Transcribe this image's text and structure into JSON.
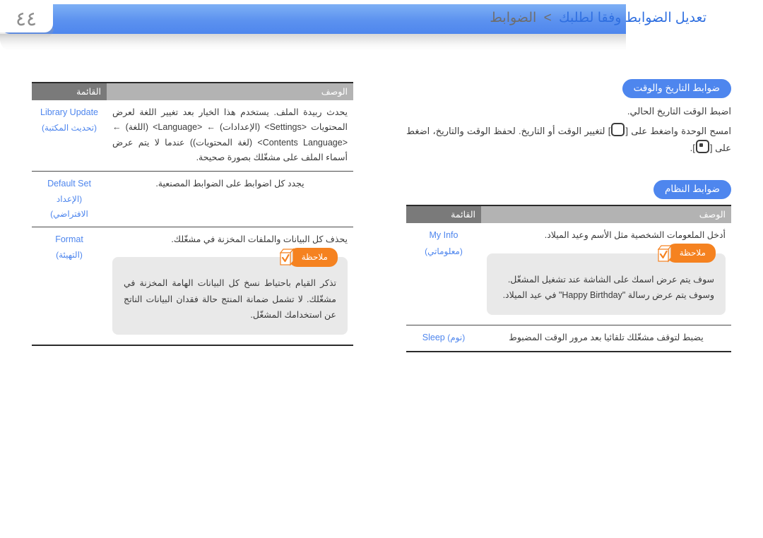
{
  "page": {
    "number": "٤٤"
  },
  "header": {
    "breadcrumb_current": "تعديل الضوابط وفقا لطلبك",
    "breadcrumb_separator": ">",
    "breadcrumb_parent": "الضوابط",
    "accent_color": "#4e86ee"
  },
  "table_headers": {
    "menu": "القائمة",
    "description": "الوصف"
  },
  "left_column": {
    "rows": [
      {
        "menu_en": "Library Update",
        "menu_ar": "(تحديث المكتبة)",
        "description": "يحدث ربيدة الملف. يستخدم هذا الخيار بعد تغيير اللغة لعرض المحتويات <Settings> (الإعدادات) ← <Language> (اللغة) ← <Contents Language> (لغة المحتويات)) عندما لا يتم عرض أسماء الملف على مشغّلك بصورة صحيحة."
      },
      {
        "menu_en": "Default Set",
        "menu_ar": "(الإعداد الافتراضي)",
        "description": "يجدد كل اضوابط على الضوابط المصنعية."
      },
      {
        "menu_en": "Format",
        "menu_ar": "(التهيئة)",
        "description": "يحذف كل البيانات والملفات المخزنة في مشغّلك.",
        "note": {
          "label": "ملاحظة",
          "text": "تذكر القيام باحتياط نسخ كل البيانات الهامة المخزنة في مشغّلك. لا تشمل ضمانة المنتج حالة فقدان البيانات الناتج عن استخدامك المشغّل."
        }
      }
    ]
  },
  "right_column": {
    "section_datetime": {
      "badge": "ضوابط التاريخ والوقت",
      "paragraph_1": "اضبط الوقت التاريخ الحالي.",
      "paragraph_2_before": "امسح الوحدة واضغط على [",
      "paragraph_2_mid": "] لتغيير الوقت أو التاريخ. لحفظ الوقت والتاريخ، اضغط على [",
      "paragraph_2_after": "]."
    },
    "section_system": {
      "badge": "ضوابط النظام",
      "rows": [
        {
          "menu_en": "My Info",
          "menu_ar": "(معلوماتي)",
          "description": "أدخل الملعومات الشخصية مثل الأسم وعيد الميلاد.",
          "note": {
            "label": "ملاحظة",
            "text_1": "سوف يتم عرض اسمك على الشاشة عند تشغيل المشغّل.",
            "text_2_before": "وسوف يتم عرض رسالة \"",
            "text_2_ltr": "Happy Birthday",
            "text_2_after": "\" في عيد الميلاد."
          }
        },
        {
          "menu_en": "Sleep",
          "menu_ar": "(نوم)",
          "description": "يضبط لتوقف مشغّلك تلقائيا بعد مرور الوقت المضبوط"
        }
      ]
    }
  },
  "icons": {
    "key_outline": "rounded-square-button-icon",
    "key_filled": "rounded-square-ok-button-icon",
    "note_badge": "note-checkbox-icon"
  }
}
